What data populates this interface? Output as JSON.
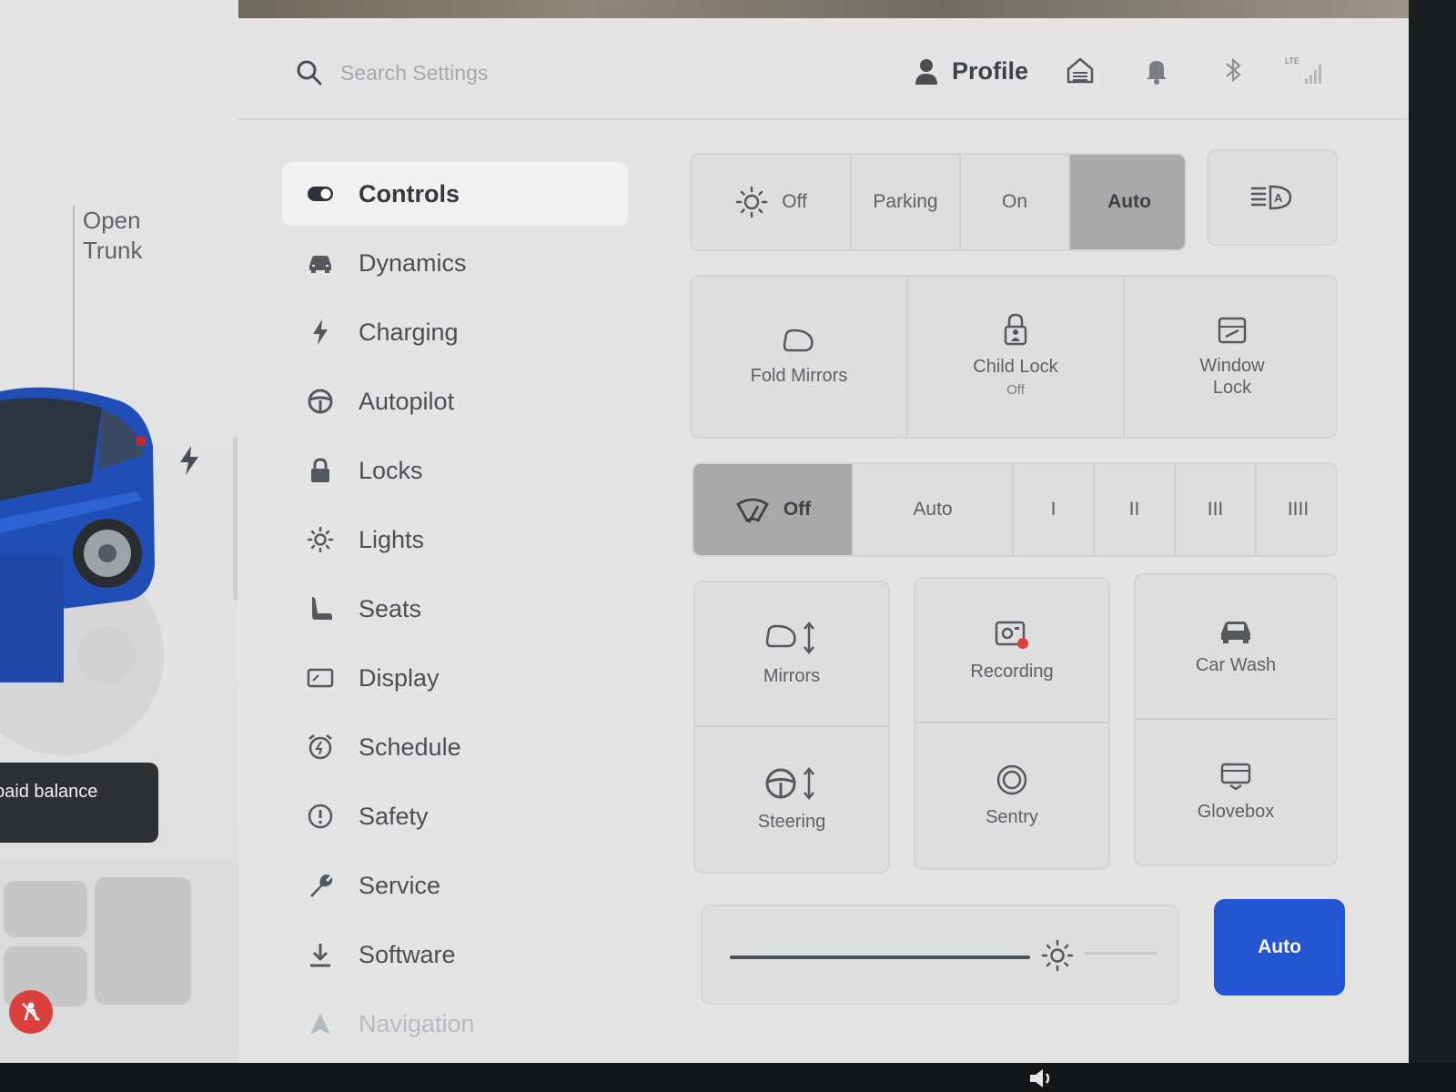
{
  "left_panel": {
    "trunk_label": "Open\nTrunk",
    "balance_toast": "paid balance"
  },
  "topbar": {
    "search_placeholder": "Search Settings",
    "profile_label": "Profile"
  },
  "sidebar": {
    "items": [
      {
        "label": "Controls",
        "icon": "toggle-icon",
        "active": true
      },
      {
        "label": "Dynamics",
        "icon": "car-icon"
      },
      {
        "label": "Charging",
        "icon": "bolt-icon"
      },
      {
        "label": "Autopilot",
        "icon": "steering-wheel-icon"
      },
      {
        "label": "Locks",
        "icon": "lock-icon"
      },
      {
        "label": "Lights",
        "icon": "sun-icon"
      },
      {
        "label": "Seats",
        "icon": "seat-icon"
      },
      {
        "label": "Display",
        "icon": "display-icon"
      },
      {
        "label": "Schedule",
        "icon": "alarm-clock-icon"
      },
      {
        "label": "Safety",
        "icon": "alert-circle-icon"
      },
      {
        "label": "Service",
        "icon": "wrench-icon"
      },
      {
        "label": "Software",
        "icon": "download-icon"
      },
      {
        "label": "Navigation",
        "icon": "navigation-arrow-icon"
      }
    ]
  },
  "controls": {
    "headlights": {
      "options": [
        "Off",
        "Parking",
        "On",
        "Auto"
      ],
      "selected": "Auto"
    },
    "mirrors_row": {
      "fold_mirrors": "Fold Mirrors",
      "child_lock": "Child Lock",
      "child_lock_state": "Off",
      "window_lock": "Window\nLock"
    },
    "wipers": {
      "options": [
        "Off",
        "Auto",
        "I",
        "II",
        "III",
        "IIII"
      ],
      "selected": "Off"
    },
    "tiles": {
      "mirrors": "Mirrors",
      "steering": "Steering",
      "recording": "Recording",
      "sentry": "Sentry",
      "car_wash": "Car Wash",
      "glovebox": "Glovebox"
    },
    "brightness": {
      "auto_label": "Auto",
      "level": 0.75
    }
  },
  "colors": {
    "accent": "#2355d1",
    "selected_segment": "#a9a9a9",
    "recording_dot": "#e0403a"
  }
}
